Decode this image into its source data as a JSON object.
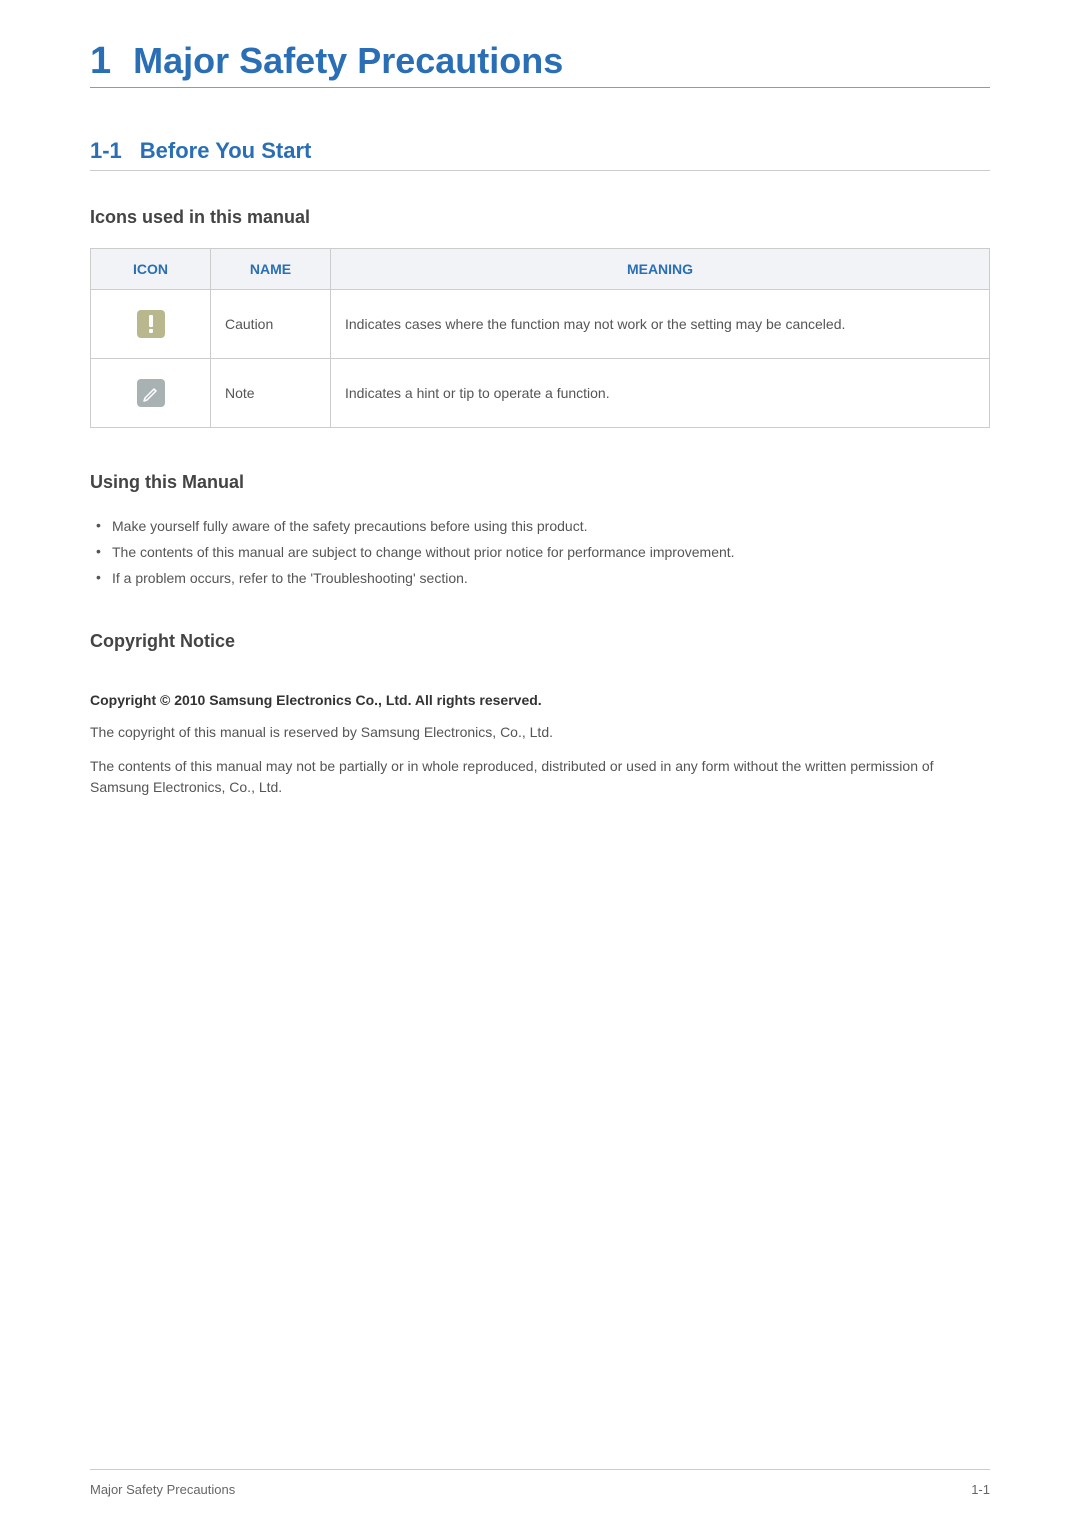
{
  "chapter": {
    "number": "1",
    "title": "Major Safety Precautions"
  },
  "section": {
    "number": "1-1",
    "title": "Before You Start"
  },
  "iconsHeading": "Icons used in this manual",
  "table": {
    "headers": {
      "icon": "ICON",
      "name": "NAME",
      "meaning": "MEANING"
    },
    "rows": [
      {
        "name": "Caution",
        "meaning": "Indicates cases where the function may not work or the setting may be canceled."
      },
      {
        "name": "Note",
        "meaning": "Indicates a hint or tip to operate a function."
      }
    ]
  },
  "usingHeading": "Using this Manual",
  "usingBullets": [
    "Make yourself fully aware of the safety precautions before using this product.",
    "The contents of this manual are subject to change without prior notice for performance improvement.",
    "If a problem occurs, refer to the 'Troubleshooting' section."
  ],
  "copyrightHeading": "Copyright Notice",
  "copyrightBold": "Copyright © 2010 Samsung Electronics Co., Ltd. All rights reserved.",
  "copyrightPara1": "The copyright of this manual is reserved by Samsung Electronics, Co., Ltd.",
  "copyrightPara2": "The contents of this manual may not be partially or in whole reproduced, distributed or used in any form without the written permission of Samsung Electronics, Co., Ltd.",
  "footer": {
    "left": "Major Safety Precautions",
    "right": "1-1"
  }
}
